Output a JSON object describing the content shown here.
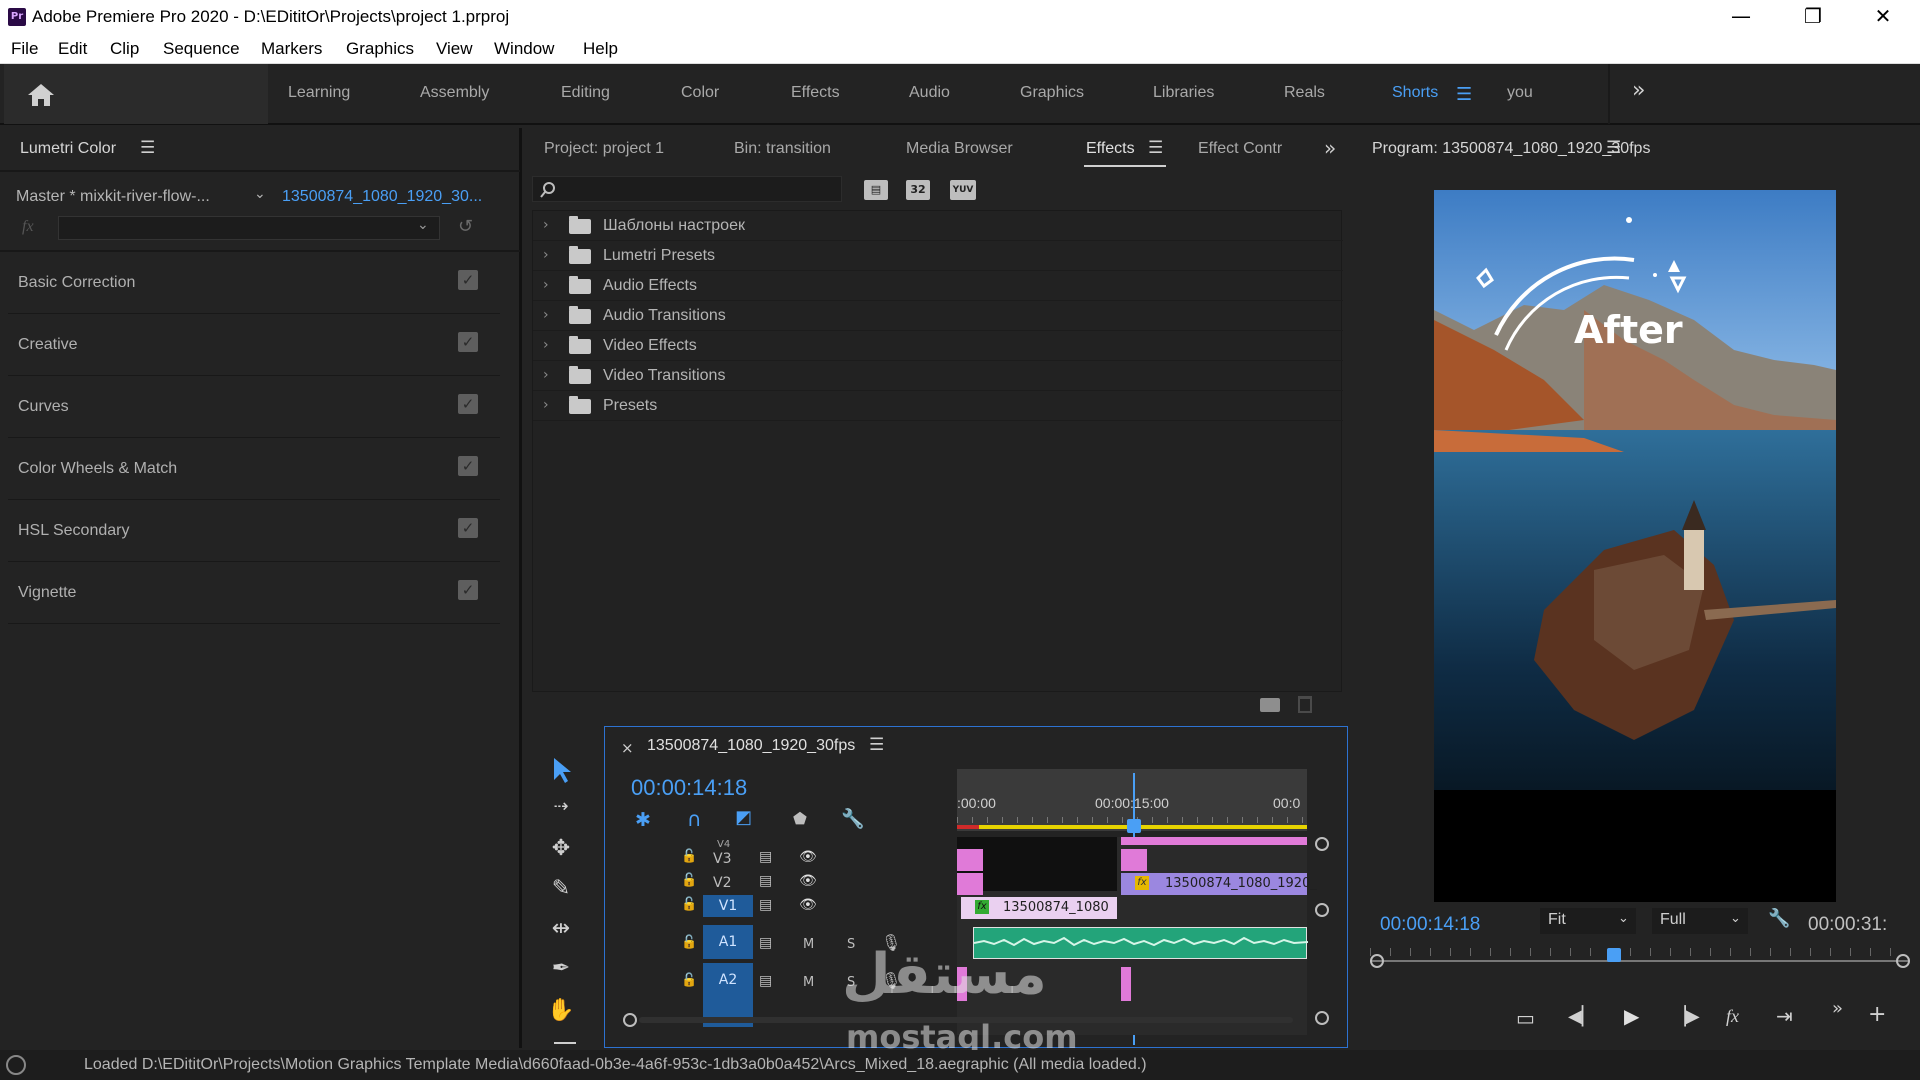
{
  "window": {
    "app_badge": "Pr",
    "title": "Adobe Premiere Pro 2020 - D:\\EDititOr\\Projects\\project 1.prproj",
    "minimize": "—",
    "maximize": "❐",
    "close": "✕"
  },
  "menu": [
    "File",
    "Edit",
    "Clip",
    "Sequence",
    "Markers",
    "Graphics",
    "View",
    "Window",
    "Help"
  ],
  "workspaces": {
    "tabs": [
      "Learning",
      "Assembly",
      "Editing",
      "Color",
      "Effects",
      "Audio",
      "Graphics",
      "Libraries",
      "Reals",
      "Shorts",
      "you"
    ],
    "active": "Shorts",
    "more": "»"
  },
  "lumetri": {
    "title": "Lumetri Color",
    "master_clip": "Master * mixkit-river-flow-...",
    "sequence_clip": "13500874_1080_1920_30...",
    "fx_label": "fx",
    "sections": [
      "Basic Correction",
      "Creative",
      "Curves",
      "Color Wheels & Match",
      "HSL Secondary",
      "Vignette"
    ]
  },
  "project_panel": {
    "tabs": [
      "Project: project 1",
      "Bin: transition",
      "Media Browser",
      "Effects",
      "Effect Contr"
    ],
    "active_tab": "Effects",
    "search_placeholder": "",
    "badges": [
      "32",
      "YUV"
    ],
    "tree": [
      "Шаблоны настроек",
      "Lumetri Presets",
      "Audio Effects",
      "Audio Transitions",
      "Video Effects",
      "Video Transitions",
      "Presets"
    ]
  },
  "timeline": {
    "sequence_name": "13500874_1080_1920_30fps",
    "timecode": "00:00:14:18",
    "ruler": [
      ":00:00",
      "00:00:15:00",
      "00:0"
    ],
    "tracks": {
      "video": [
        "V4",
        "V3",
        "V2",
        "V1"
      ],
      "audio": [
        "A1",
        "A2"
      ],
      "mute": "M",
      "solo": "S"
    },
    "clips": {
      "v2_clip": "13500874_1080_1920_",
      "v1_clip": "13500874_1080",
      "fx": "fx"
    }
  },
  "program": {
    "title": "Program: 13500874_1080_1920_30fps",
    "overlay_text": "After",
    "timecode": "00:00:14:18",
    "duration": "00:00:31:",
    "fit": "Fit",
    "resolution": "Full",
    "playhead_fraction": 0.45
  },
  "watermark": {
    "arabic": "مستقل",
    "latin": "mostaql.com"
  },
  "status": {
    "message": "Loaded D:\\EDititOr\\Projects\\Motion Graphics Template Media\\d660faad-0b3e-4a6f-953c-1db3a0b0a452\\Arcs_Mixed_18.aegraphic (All media loaded.)"
  },
  "colors": {
    "accent": "#4a9ff5",
    "panel_bg": "#232323",
    "clip_pink": "#e07ad8",
    "clip_purple": "#9b87e0",
    "audio_green": "#23a47a"
  }
}
